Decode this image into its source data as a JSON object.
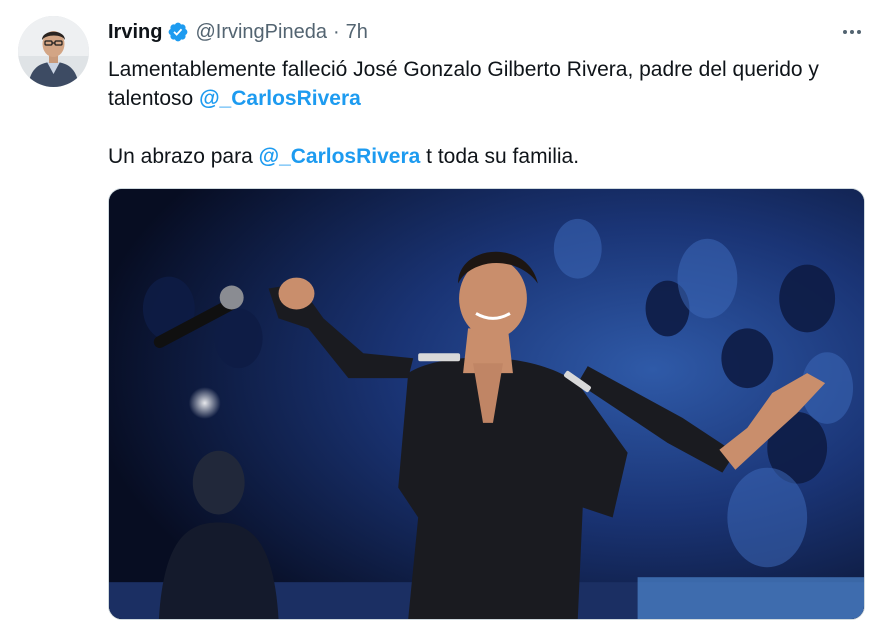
{
  "tweet": {
    "display_name": "Irving",
    "handle": "@IrvingPineda",
    "separator": "·",
    "time": "7h",
    "line1_text": "Lamentablemente falleció José Gonzalo Gilberto Rivera, padre del querido y talentoso ",
    "line1_mention": "@_CarlosRivera",
    "line2_text_before": "Un abrazo para ",
    "line2_mention": "@_CarlosRivera",
    "line2_text_after": " t toda su familia."
  },
  "icons": {
    "verified": "verified-badge-icon",
    "more": "more-options-icon"
  },
  "colors": {
    "accent": "#1d9bf0",
    "text": "#0f1419",
    "secondary": "#536471"
  }
}
